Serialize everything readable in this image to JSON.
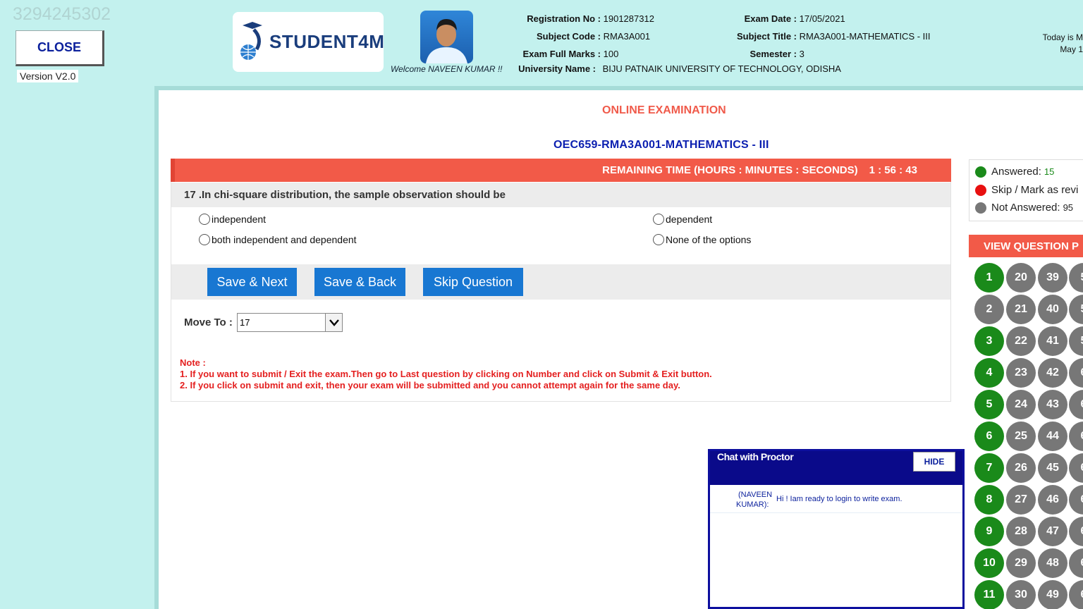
{
  "header": {
    "watermark_id": "3294245302",
    "close_label": "CLOSE",
    "version": "Version V2.0",
    "logo_text": "STUDENT4M",
    "welcome": "Welcome NAVEEN KUMAR !!",
    "today_line1": "Today is M",
    "today_line2": "May 1"
  },
  "info": {
    "reg_label": "Registration No :",
    "reg_value": "1901287312",
    "code_label": "Subject Code :",
    "code_value": "RMA3A001",
    "marks_label": "Exam Full Marks :",
    "marks_value": "100",
    "univ_label": "University Name :",
    "univ_value": "BIJU PATNAIK UNIVERSITY OF TECHNOLOGY, ODISHA",
    "date_label": "Exam Date :",
    "date_value": "17/05/2021",
    "title_label": "Subject Title :",
    "title_value": "RMA3A001-MATHEMATICS - III",
    "sem_label": "Semester :",
    "sem_value": "3"
  },
  "exam": {
    "heading": "ONLINE EXAMINATION",
    "subject": "OEC659-RMA3A001-MATHEMATICS - III",
    "timer_label": "REMAINING TIME (HOURS : MINUTES : SECONDS)",
    "timer_value": "1 : 56 : 43",
    "question": "17 .In chi-square distribution, the sample observation should be",
    "options": [
      "independent",
      "dependent",
      "both independent and dependent",
      "None of the options"
    ],
    "buttons": {
      "save_next": "Save & Next",
      "save_back": "Save & Back",
      "skip": "Skip Question"
    },
    "move_label": "Move To :",
    "move_value": "17",
    "note_title": "Note :",
    "note_1": "1. If you want to submit / Exit the exam.Then go to Last question by clicking on Number and click on Submit & Exit button.",
    "note_2": "2. If you click on submit and exit, then your exam will be submitted and you cannot attempt again for the same day."
  },
  "legend": {
    "answered_label": "Answered:",
    "answered_count": "15",
    "skip_label": "Skip / Mark as revi",
    "not_answered_label": "Not Answered:",
    "not_answered_count": "95"
  },
  "palette": {
    "title": "VIEW QUESTION P",
    "columns": [
      [
        "1",
        "2",
        "3",
        "4",
        "5",
        "6",
        "7",
        "8",
        "9",
        "10",
        "11"
      ],
      [
        "20",
        "21",
        "22",
        "23",
        "24",
        "25",
        "26",
        "27",
        "28",
        "29",
        "30"
      ],
      [
        "39",
        "40",
        "41",
        "42",
        "43",
        "44",
        "45",
        "46",
        "47",
        "48",
        "49"
      ],
      [
        "5",
        "5",
        "5",
        "6",
        "6",
        "6",
        "6",
        "6",
        "6",
        "6",
        "6"
      ]
    ],
    "answered": [
      "1",
      "3",
      "4",
      "5",
      "6",
      "7",
      "8",
      "9",
      "10",
      "11"
    ]
  },
  "chat": {
    "title": "Chat with Proctor",
    "hide_label": "HIDE",
    "sender_line1": "(NAVEEN",
    "sender_line2": "KUMAR):",
    "message": "Hi ! Iam ready to login to write exam."
  },
  "colors": {
    "accent_red": "#f25a48",
    "answered_green": "#1a8a1a",
    "skip_red": "#e81010",
    "grey": "#777777",
    "button_blue": "#1877d2"
  }
}
